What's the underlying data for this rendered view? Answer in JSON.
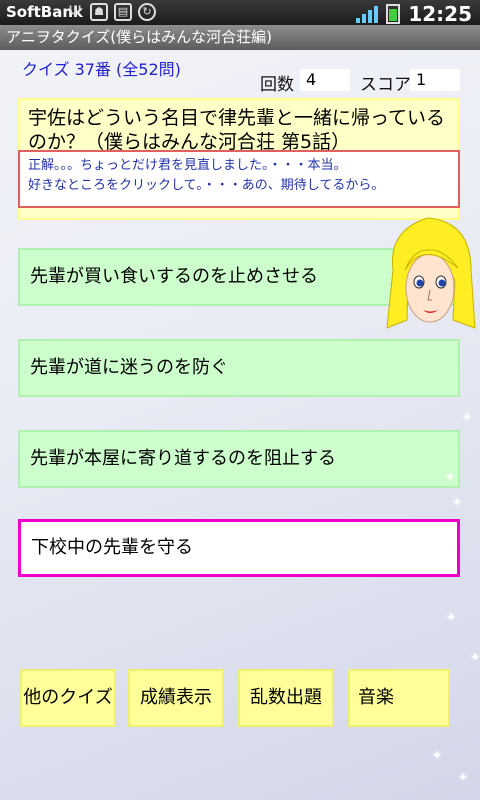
{
  "status_bar": {
    "carrier": "SoftBank",
    "time": "12:25"
  },
  "title_bar": {
    "title": "アニヲタクイズ(僕らはみんな河合荘編)"
  },
  "quiz": {
    "number_label": "クイズ 37番 (全52問)",
    "count_label": "回数",
    "count_value": "4",
    "score_label": "スコア",
    "score_value": "1",
    "question": "宇佐はどういう名目で律先輩と一緒に帰っているのか？（僕らはみんな河合荘 第5話）",
    "feedback_line1": "正解。。。ちょっとだけ君を見直しました。・・・本当。",
    "feedback_line2": "好きなところをクリックして。・・・あの、期待してるから。"
  },
  "answers": [
    {
      "label": "先輩が買い食いするのを止めさせる",
      "selected": false
    },
    {
      "label": "先輩が道に迷うのを防ぐ",
      "selected": false
    },
    {
      "label": "先輩が本屋に寄り道するのを阻止する",
      "selected": false
    },
    {
      "label": "下校中の先輩を守る",
      "selected": true
    }
  ],
  "bottom_buttons": {
    "other_quiz": "他のクイズ",
    "show_results": "成績表示",
    "random_question": "乱数出題",
    "music": "音楽"
  },
  "colors": {
    "question_bg": "#ffffc8",
    "answer_bg": "#ccffcc",
    "selected_border": "#ee00cc",
    "button_bg": "#ffff99",
    "feedback_border": "#e06060",
    "link_blue": "#2222cc"
  },
  "icons": [
    "usb-icon",
    "android-debug-icon",
    "sim-icon",
    "sync-icon",
    "signal-icon",
    "battery-icon"
  ]
}
